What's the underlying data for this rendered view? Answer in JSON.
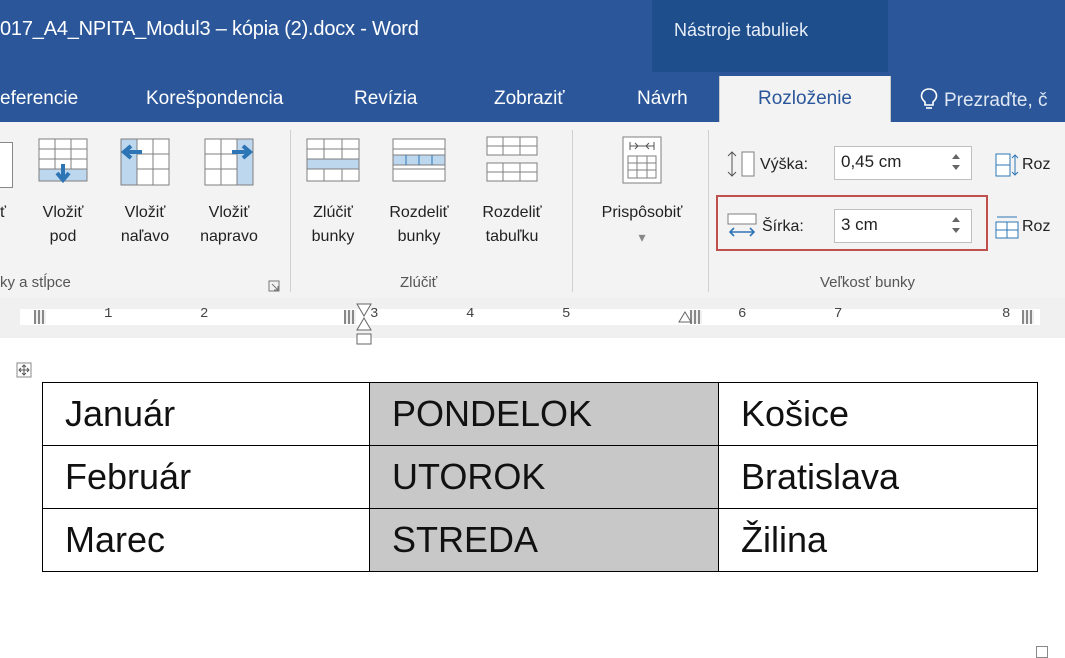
{
  "window": {
    "title": "017_A4_NPITA_Modul3 – kópia (2).docx - Word",
    "context_tab_group": "Nástroje tabuliek"
  },
  "tabs": [
    {
      "label": "eferencie"
    },
    {
      "label": "Korešpondencia"
    },
    {
      "label": "Revízia"
    },
    {
      "label": "Zobraziť"
    },
    {
      "label": "Návrh"
    },
    {
      "label": "Rozloženie",
      "active": true
    },
    {
      "label": "Prezraďte, č"
    }
  ],
  "ribbon": {
    "rows_cols_group": {
      "label": "ky a stĺpce",
      "buttons": [
        {
          "label_line1": "ť",
          "label_line2": ""
        },
        {
          "label_line1": "Vložiť",
          "label_line2": "pod",
          "icon": "insert-below-icon"
        },
        {
          "label_line1": "Vložiť",
          "label_line2": "naľavo",
          "icon": "insert-left-icon"
        },
        {
          "label_line1": "Vložiť",
          "label_line2": "napravo",
          "icon": "insert-right-icon"
        }
      ]
    },
    "merge_group": {
      "label": "Zlúčiť",
      "buttons": [
        {
          "label_line1": "Zlúčiť",
          "label_line2": "bunky"
        },
        {
          "label_line1": "Rozdeliť",
          "label_line2": "bunky"
        },
        {
          "label_line1": "Rozdeliť",
          "label_line2": "tabuľku"
        }
      ]
    },
    "autofit": {
      "label": "Prispôsobiť",
      "arrow": "▾"
    },
    "cell_size_group": {
      "label": "Veľkosť bunky",
      "height_label": "Výška:",
      "height_value": "0,45 cm",
      "width_label": "Šírka:",
      "width_value": "3 cm",
      "dist_rows": "Roz",
      "dist_cols": "Roz"
    }
  },
  "ruler": {
    "numbers": [
      "1",
      "2",
      "3",
      "4",
      "5",
      "6",
      "7",
      "8"
    ]
  },
  "document_table": {
    "rows": [
      [
        "Január",
        "PONDELOK",
        "Košice"
      ],
      [
        "Február",
        "UTOROK",
        "Bratislava"
      ],
      [
        "Marec",
        "STREDA",
        "Žilina"
      ]
    ]
  },
  "colors": {
    "ribbon_blue": "#2b579a",
    "highlight_red": "#c0504d",
    "shaded_cell": "#c8c8c8"
  }
}
